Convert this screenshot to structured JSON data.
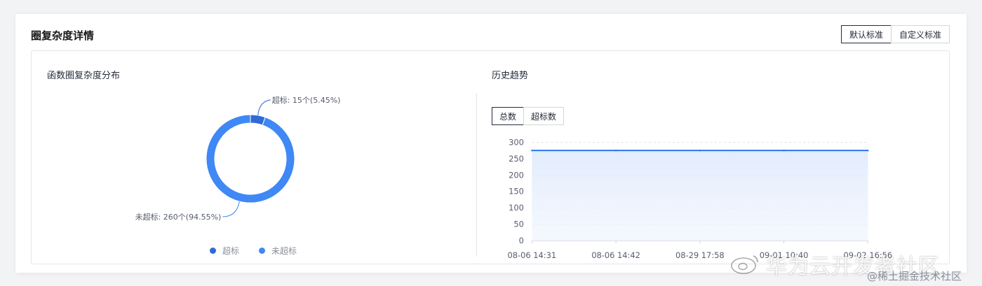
{
  "header": {
    "title": "圈复杂度详情",
    "toggle": [
      "默认标准",
      "自定义标准"
    ],
    "toggle_active": 0
  },
  "left_panel": {
    "title": "函数圈复杂度分布"
  },
  "right_panel": {
    "title": "历史趋势",
    "tabs": [
      "总数",
      "超标数"
    ],
    "tab_active": 0
  },
  "chart_data": [
    {
      "type": "pie",
      "title": "函数圈复杂度分布",
      "slices": [
        {
          "name": "超标",
          "value": 15,
          "percent": 5.45,
          "label": "超标: 15个(5.45%)",
          "color": "#2f6ad6"
        },
        {
          "name": "未超标",
          "value": 260,
          "percent": 94.55,
          "label": "未超标: 260个(94.55%)",
          "color": "#3f88f5"
        }
      ],
      "legend": [
        "超标",
        "未超标"
      ],
      "legend_position": "bottom"
    },
    {
      "type": "area",
      "title": "历史趋势",
      "categories": [
        "08-06 14:31",
        "08-06 14:42",
        "08-29 17:58",
        "09-01 10:40",
        "09-02 16:56"
      ],
      "values": [
        275,
        275,
        275,
        275,
        275
      ],
      "ylim": [
        0,
        300
      ],
      "yticks": [
        0,
        50,
        100,
        150,
        200,
        250,
        300
      ],
      "grid": true,
      "color": "#1f6ff0"
    }
  ],
  "watermark": {
    "main": "华为云开发者社区",
    "sub": "@稀土掘金技术社区"
  }
}
